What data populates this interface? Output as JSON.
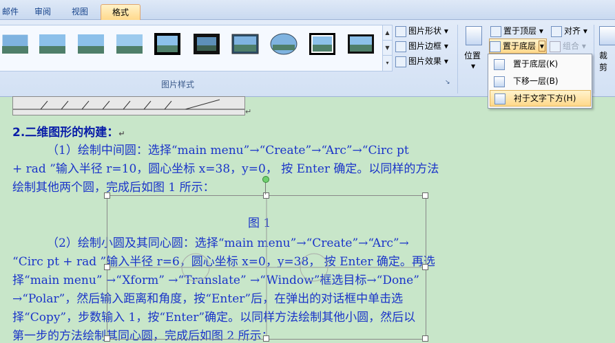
{
  "tabs": [
    "邮件",
    "审阅",
    "视图",
    "格式"
  ],
  "ribbon": {
    "picture_styles_label": "图片样式",
    "commands": {
      "picture_shape": "图片形状",
      "picture_border": "图片边框",
      "picture_effects": "图片效果",
      "bring_to_front": "置于顶层",
      "send_to_back": "置于底层",
      "align": "对齐",
      "group": "组合",
      "position": "位置",
      "crop": "裁剪"
    }
  },
  "dropdown": {
    "items": [
      "置于底层(K)",
      "下移一层(B)",
      "衬于文字下方(H)"
    ]
  },
  "document": {
    "heading": "2.二维图形的构建：",
    "para1_line1": "（1）绘制中间圆：选择“main menu”→“Create”→“Arc”→“Circ pt",
    "para1_line2": "+ rad ”输入半径 r=10，圆心坐标 x=38，y=0， 按 Enter 确定。以同样的方法",
    "para1_line3": "绘制其他两个圆，完成后如图 1 所示：",
    "figure_caption": "图 1",
    "para2_line1": "（2）绘制小圆及其同心圆：选择“main menu”→“Create”→“Arc”→",
    "para2_line2": "“Circ pt + rad ”输入半径 r=6，圆心坐标 x=0，y=38， 按 Enter 确定。再选",
    "para2_line3": "择“main menu” →“Xform” →“Translate” →“Window”框选目标→“Done”",
    "para2_line4": "→“Polar”，然后输入距离和角度，按“Enter”后，在弹出的对话框中单击选",
    "para2_line5": "择“Copy”，步数输入 1，按“Enter”确定。以同样方法绘制其他小圆，然后以",
    "para2_line6": "第一步的方法绘制其同心圆，完成后如图 2 所示："
  },
  "colors": {
    "doc_bg": "#c8e6c9",
    "text": "#1a34c9",
    "menu_highlight": "#ffd88a"
  }
}
